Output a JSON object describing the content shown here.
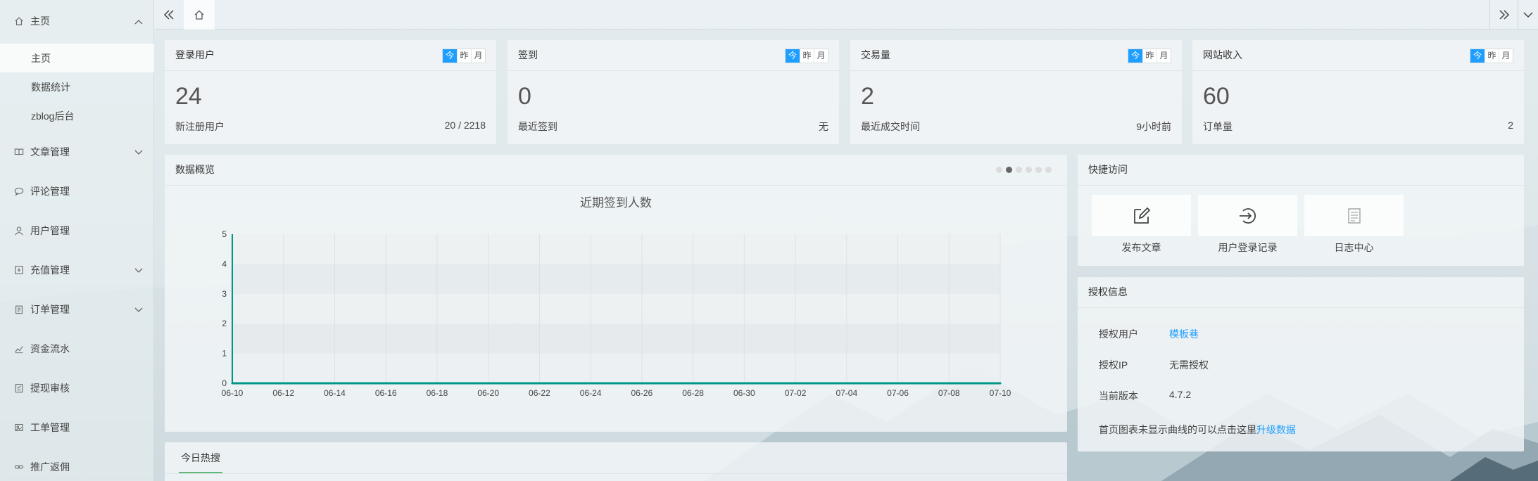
{
  "sidebar": {
    "items": [
      {
        "label": "主页",
        "icon": "home-icon",
        "expanded": true,
        "children": [
          "主页",
          "数据统计",
          "zblog后台"
        ]
      },
      {
        "label": "文章管理",
        "icon": "book-icon",
        "has_children": true
      },
      {
        "label": "评论管理",
        "icon": "comment-icon",
        "has_children": false
      },
      {
        "label": "用户管理",
        "icon": "user-icon",
        "has_children": false
      },
      {
        "label": "充值管理",
        "icon": "recharge-icon",
        "has_children": true
      },
      {
        "label": "订单管理",
        "icon": "order-icon",
        "has_children": true
      },
      {
        "label": "资金流水",
        "icon": "cashflow-icon",
        "has_children": false
      },
      {
        "label": "提现审核",
        "icon": "withdraw-icon",
        "has_children": false
      },
      {
        "label": "工单管理",
        "icon": "ticket-icon",
        "has_children": false
      },
      {
        "label": "推广返佣",
        "icon": "link-icon",
        "has_children": false
      }
    ],
    "active_sub": "主页"
  },
  "stats": [
    {
      "title": "登录用户",
      "value": "24",
      "label": "新注册用户",
      "right": "20 / 2218"
    },
    {
      "title": "签到",
      "value": "0",
      "label": "最近签到",
      "right": "无"
    },
    {
      "title": "交易量",
      "value": "2",
      "label": "最近成交时间",
      "right": "9小时前"
    },
    {
      "title": "网站收入",
      "value": "60",
      "label": "订单量",
      "right": "2"
    }
  ],
  "period": {
    "today": "今",
    "yesterday": "昨",
    "month": "月"
  },
  "overview": {
    "title": "数据概览",
    "dots": 6,
    "active_dot": 1
  },
  "chart_data": {
    "type": "line",
    "title": "近期签到人数",
    "x": [
      "06-10",
      "06-12",
      "06-14",
      "06-16",
      "06-18",
      "06-20",
      "06-22",
      "06-24",
      "06-26",
      "06-28",
      "06-30",
      "07-02",
      "07-04",
      "07-06",
      "07-08",
      "07-10"
    ],
    "series": [
      {
        "values": [
          0,
          0,
          0,
          0,
          0,
          0,
          0,
          0,
          0,
          0,
          0,
          0,
          0,
          0,
          0,
          0
        ]
      }
    ],
    "yticks": [
      "0",
      "1",
      "2",
      "3",
      "4",
      "5"
    ],
    "ylim": [
      0,
      5
    ],
    "grid": true,
    "line_color": "#009688"
  },
  "quick": {
    "title": "快捷访问",
    "items": [
      {
        "label": "发布文章",
        "icon": "edit-icon"
      },
      {
        "label": "用户登录记录",
        "icon": "login-icon"
      },
      {
        "label": "日志中心",
        "icon": "log-icon"
      }
    ]
  },
  "license": {
    "title": "授权信息",
    "rows": [
      {
        "key": "授权用户",
        "value": "模板巷",
        "link": true
      },
      {
        "key": "授权IP",
        "value": "无需授权",
        "link": false
      },
      {
        "key": "当前版本",
        "value": "4.7.2",
        "link": false
      }
    ],
    "note": "首页图表未显示曲线的可以点击这里",
    "note_link": "升级数据"
  },
  "hot": {
    "tab": "今日热搜"
  }
}
